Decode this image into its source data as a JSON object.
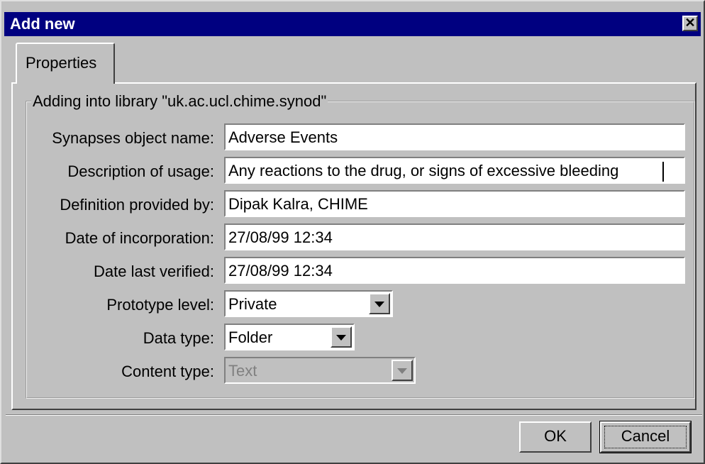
{
  "window": {
    "title": "Add new",
    "close_glyph": "✕"
  },
  "tabs": [
    {
      "label": "Properties",
      "selected": true
    }
  ],
  "group": {
    "legend": "Adding into library \"uk.ac.ucl.chime.synod\""
  },
  "fields": {
    "object_name": {
      "label": "Synapses object name:",
      "value": "Adverse Events"
    },
    "description": {
      "label": "Description of usage:",
      "value": "Any reactions to the drug, or signs of excessive bleeding"
    },
    "definition_by": {
      "label": "Definition provided by:",
      "value": "Dipak Kalra, CHIME"
    },
    "date_incorp": {
      "label": "Date of incorporation:",
      "value": "27/08/99 12:34"
    },
    "date_verified": {
      "label": "Date last verified:",
      "value": "27/08/99 12:34"
    }
  },
  "combos": {
    "prototype_level": {
      "label": "Prototype level:",
      "value": "Private",
      "enabled": true
    },
    "data_type": {
      "label": "Data type:",
      "value": "Folder",
      "enabled": true
    },
    "content_type": {
      "label": "Content type:",
      "value": "Text",
      "enabled": false
    }
  },
  "buttons": {
    "ok": "OK",
    "cancel": "Cancel"
  },
  "colors": {
    "titlebar": "#000080",
    "face": "#c0c0c0",
    "field": "#ffffff"
  }
}
